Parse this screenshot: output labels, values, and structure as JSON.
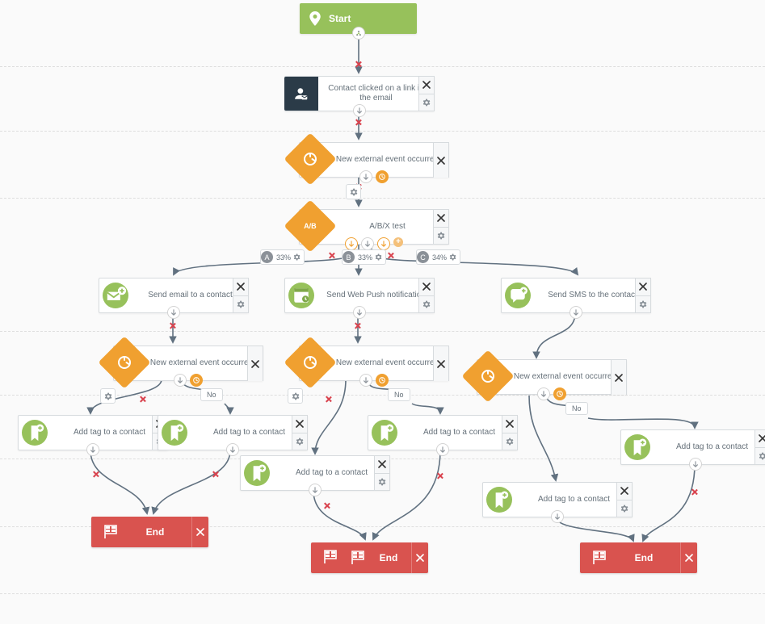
{
  "start": {
    "label": "Start"
  },
  "clickEmail": {
    "label": "Contact clicked on a link in the email"
  },
  "event1": {
    "label": "New external event occurred"
  },
  "abx": {
    "label": "A/B/X test",
    "icon": "A/B"
  },
  "split": {
    "a": {
      "letter": "A",
      "pct": "33%"
    },
    "b": {
      "letter": "B",
      "pct": "33%"
    },
    "c": {
      "letter": "C",
      "pct": "34%"
    }
  },
  "sendEmail": {
    "label": "Send email to a contact"
  },
  "sendPush": {
    "label": "Send Web Push notification"
  },
  "sendSMS": {
    "label": "Send SMS to the contact"
  },
  "eventA": {
    "label": "New external event occurred"
  },
  "eventB": {
    "label": "New external event occurred"
  },
  "eventC": {
    "label": "New external event occurred"
  },
  "tag1": {
    "label": "Add tag to a contact"
  },
  "tag2": {
    "label": "Add tag to a contact"
  },
  "tag3": {
    "label": "Add tag to a contact"
  },
  "tag4": {
    "label": "Add tag to a contact"
  },
  "tag5": {
    "label": "Add tag to a contact"
  },
  "tag6": {
    "label": "Add tag to a contact"
  },
  "noLabel": "No",
  "end": {
    "label": "End"
  }
}
